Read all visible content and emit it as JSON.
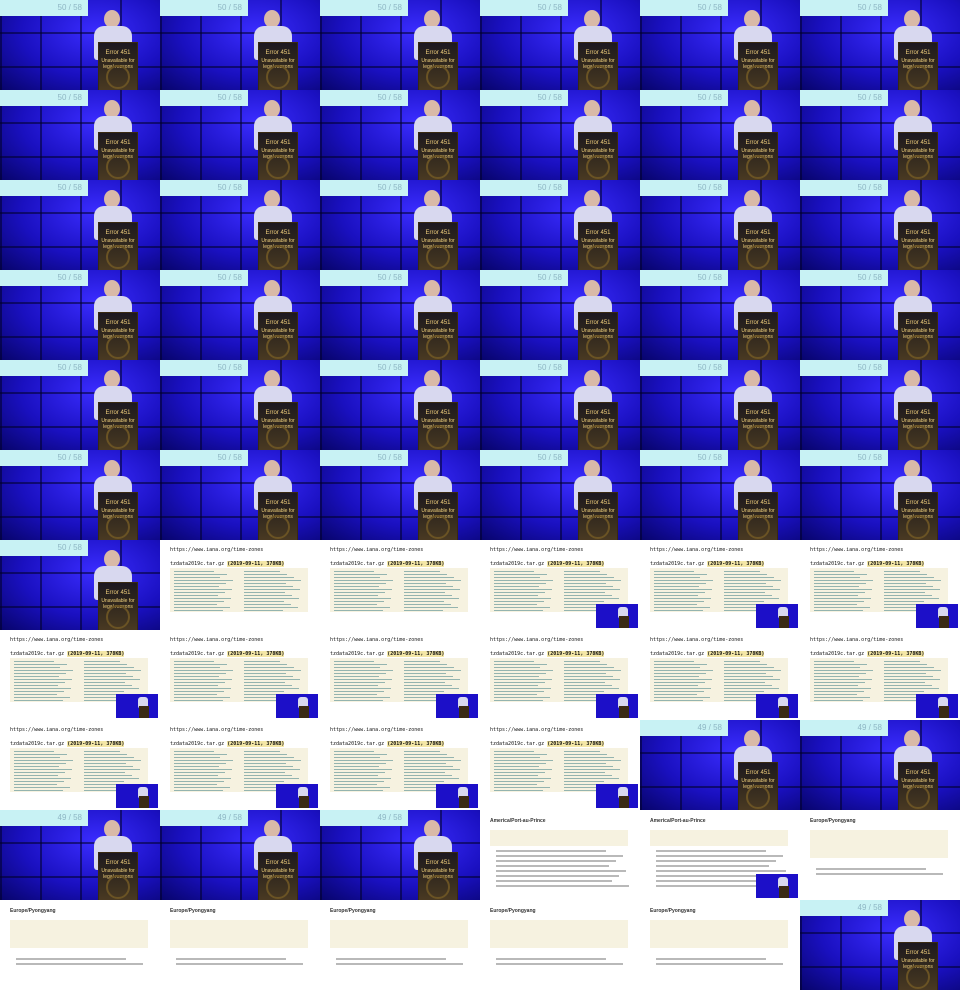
{
  "stage": {
    "counter_a": "50 / 58",
    "counter_b": "49 / 58",
    "podium_line1": "Error 451",
    "podium_line2": "Unavailable for legal reasons"
  },
  "slide_tz": {
    "url": "https://www.iana.org/time-zones",
    "file_name": "tzdata2019c.tar.gz",
    "file_meta": "(2019-09-11, 378KB)"
  },
  "slide_america": {
    "title": "America/Port-au-Prince"
  },
  "slide_europe": {
    "title": "Europe/Pyongyang"
  },
  "tiles": [
    "s",
    "s",
    "s",
    "s",
    "s",
    "s",
    "s",
    "s",
    "s",
    "s",
    "s",
    "s",
    "s",
    "s",
    "s",
    "s",
    "s",
    "s",
    "s",
    "s",
    "s",
    "s",
    "s",
    "s",
    "s",
    "s",
    "s",
    "s",
    "s",
    "s",
    "s",
    "s",
    "s",
    "s",
    "s",
    "s",
    "s",
    "tz",
    "tz",
    "tzp",
    "tzp",
    "tzp",
    "tzp",
    "tzp",
    "tzp",
    "tzp",
    "tzp",
    "tzp",
    "tzp",
    "tzp",
    "tzp",
    "tzp",
    "b",
    "b",
    "b",
    "b",
    "b",
    "am",
    "amp",
    "eu",
    "eu",
    "eu",
    "eu",
    "eu",
    "eu",
    "b"
  ]
}
